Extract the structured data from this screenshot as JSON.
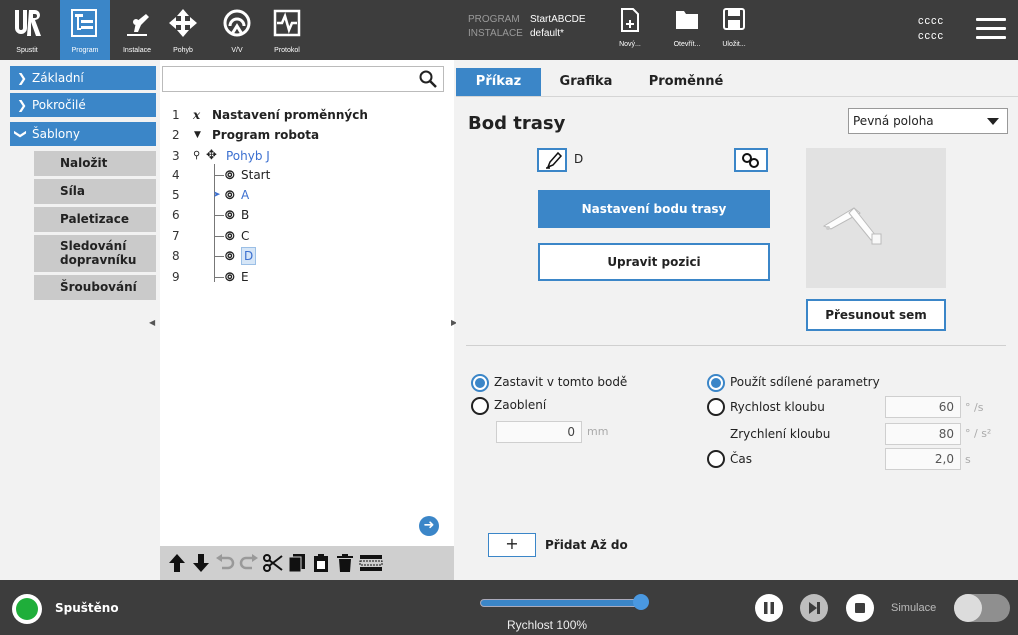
{
  "header": {
    "nav": [
      {
        "label": "Spustit",
        "icon": "ur-logo-icon"
      },
      {
        "label": "Program",
        "icon": "program-icon"
      },
      {
        "label": "Instalace",
        "icon": "installation-icon"
      },
      {
        "label": "Pohyb",
        "icon": "move-icon"
      },
      {
        "label": "V/V",
        "icon": "io-icon"
      },
      {
        "label": "Protokol",
        "icon": "log-icon"
      }
    ],
    "program_key": "PROGRAM",
    "program_value": "StartABCDE",
    "installation_key": "INSTALACE",
    "installation_value": "default*",
    "file_buttons": [
      {
        "label": "Nový...",
        "icon": "new-file-icon"
      },
      {
        "label": "Otevřít...",
        "icon": "open-folder-icon"
      },
      {
        "label": "Uložit...",
        "icon": "save-icon"
      }
    ],
    "user_line1": "cccc",
    "user_line2": "cccc"
  },
  "leftnav": {
    "groups": [
      "Základní",
      "Pokročilé",
      "Šablony"
    ],
    "items": [
      "Naložit",
      "Síla",
      "Paletizace",
      "Sledování dopravníku",
      "Šroubování"
    ]
  },
  "tree": {
    "search_placeholder": "",
    "rows": [
      {
        "num": "1",
        "text": "Nastavení proměnných"
      },
      {
        "num": "2",
        "text": "Program robota"
      },
      {
        "num": "3",
        "text": "Pohyb J"
      },
      {
        "num": "4",
        "text": "Start"
      },
      {
        "num": "5",
        "text": "A"
      },
      {
        "num": "6",
        "text": "B"
      },
      {
        "num": "7",
        "text": "C"
      },
      {
        "num": "8",
        "text": "D"
      },
      {
        "num": "9",
        "text": "E"
      }
    ]
  },
  "right": {
    "tabs": [
      "Příkaz",
      "Grafika",
      "Proměnné"
    ],
    "title": "Bod trasy",
    "pose_select": "Pevná poloha",
    "waypoint_name": "D",
    "set_waypoint": "Nastavení bodu trasy",
    "edit_pose": "Upravit pozici",
    "move_here": "Přesunout sem",
    "stop_here": "Zastavit v tomto bodě",
    "blend": "Zaoblení",
    "blend_value": "0",
    "blend_unit": "mm",
    "shared_params": "Použít sdílené parametry",
    "joint_speed": "Rychlost kloubu",
    "joint_speed_value": "60",
    "joint_speed_unit": "° /s",
    "joint_accel": "Zrychlení kloubu",
    "joint_accel_value": "80",
    "joint_accel_unit": "° / s²",
    "time": "Čas",
    "time_value": "2,0",
    "time_unit": "s",
    "add_until": "Přidat Až do",
    "add_symbol": "+"
  },
  "footer": {
    "status": "Spuštěno",
    "speed": "Rychlost 100%",
    "speed_fraction": 1.0,
    "simulation": "Simulace",
    "colors": {
      "accent": "#3b86c8",
      "running": "#1fae3a"
    }
  }
}
